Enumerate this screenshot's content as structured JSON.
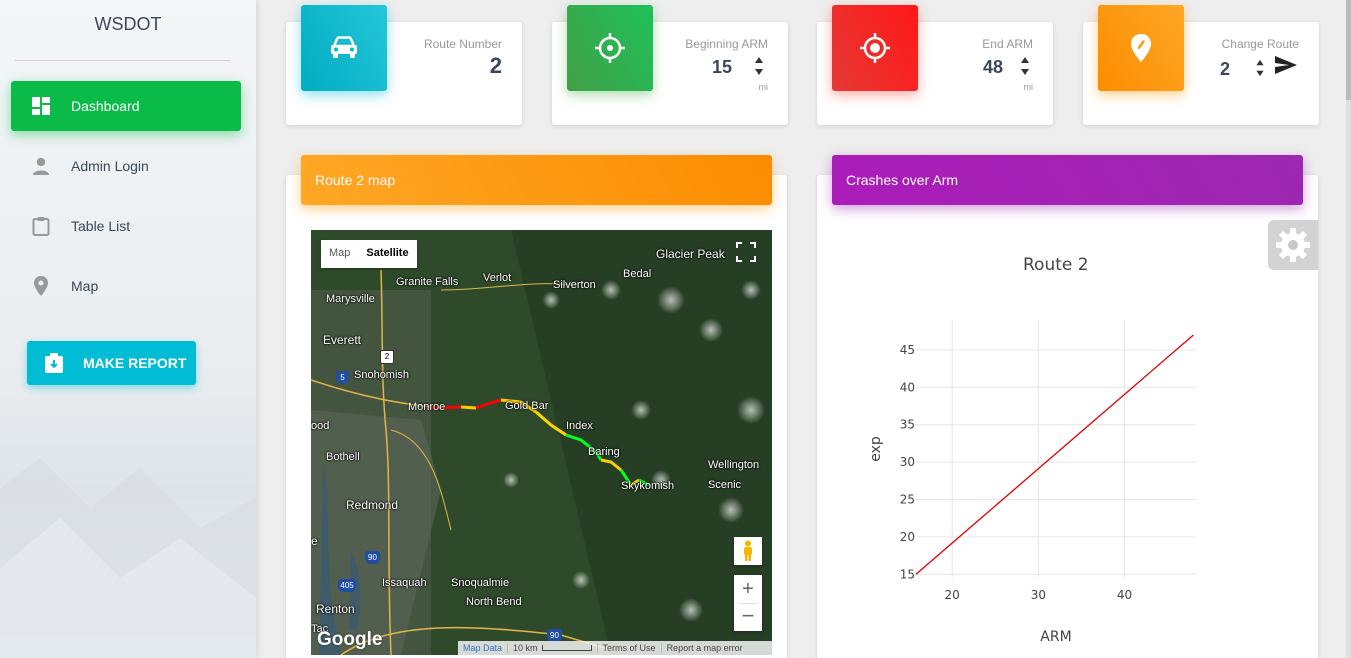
{
  "sidebar": {
    "brand": "WSDOT",
    "items": [
      {
        "label": "Dashboard",
        "icon": "dashboard-icon",
        "active": true
      },
      {
        "label": "Admin Login",
        "icon": "person-icon",
        "active": false
      },
      {
        "label": "Table List",
        "icon": "clipboard-icon",
        "active": false
      },
      {
        "label": "Map",
        "icon": "location-pin-icon",
        "active": false
      }
    ],
    "report_button": "MAKE REPORT"
  },
  "stats": {
    "route_number": {
      "label": "Route Number",
      "value": "2",
      "color": "#00bcd4",
      "icon": "car-icon"
    },
    "beginning_arm": {
      "label": "Beginning ARM",
      "value": "15",
      "unit": "mi",
      "color": "#43a047",
      "icon": "crosshair-icon"
    },
    "end_arm": {
      "label": "End ARM",
      "value": "48",
      "unit": "mi",
      "color": "#f44336",
      "icon": "target-icon"
    },
    "change_route": {
      "label": "Change Route",
      "value": "2",
      "color": "#ff9800",
      "icon": "edit-pin-icon"
    }
  },
  "map_panel": {
    "title": "Route 2 map",
    "color": "#ff9800",
    "type_buttons": [
      "Map",
      "Satellite"
    ],
    "selected_type": "Satellite",
    "places": {
      "glacier_peak": "Glacier Peak",
      "granite_falls": "Granite Falls",
      "verlot": "Verlot",
      "bedal": "Bedal",
      "marysville": "Marysville",
      "silverton": "Silverton",
      "everett": "Everett",
      "snohomish": "Snohomish",
      "monroe": "Monroe",
      "gold_bar": "Gold Bar",
      "index": "Index",
      "wood": "ood",
      "bothell": "Bothell",
      "baring": "Baring",
      "wellington": "Wellington",
      "scenic": "Scenic",
      "skykomish": "Skykomish",
      "redmond": "Redmond",
      "e": "e",
      "issaquah": "Issaquah",
      "snoqualmie": "Snoqualmie",
      "north_bend": "North Bend",
      "renton": "Renton",
      "tac": "Tac"
    },
    "shields": {
      "us2": "2",
      "i5": "5",
      "i90a": "90",
      "i405": "405",
      "i90b": "90"
    },
    "google_logo": "Google",
    "footer": {
      "map_data": "Map Data",
      "scale": "10 km",
      "terms": "Terms of Use",
      "report": "Report a map error"
    }
  },
  "chart_panel": {
    "title": "Crashes over Arm",
    "color": "#9c27b0"
  },
  "chart_data": {
    "type": "line",
    "title": "Route 2",
    "xlabel": "ARM",
    "ylabel": "exp",
    "xlim": [
      15.8,
      48.3
    ],
    "ylim": [
      14.5,
      49
    ],
    "xticks": [
      20,
      30,
      40
    ],
    "yticks": [
      15,
      20,
      25,
      30,
      35,
      40,
      45
    ],
    "grid": true,
    "series": [
      {
        "color": "#e00000",
        "x": [
          15.8,
          48
        ],
        "y": [
          15,
          47
        ]
      }
    ]
  }
}
